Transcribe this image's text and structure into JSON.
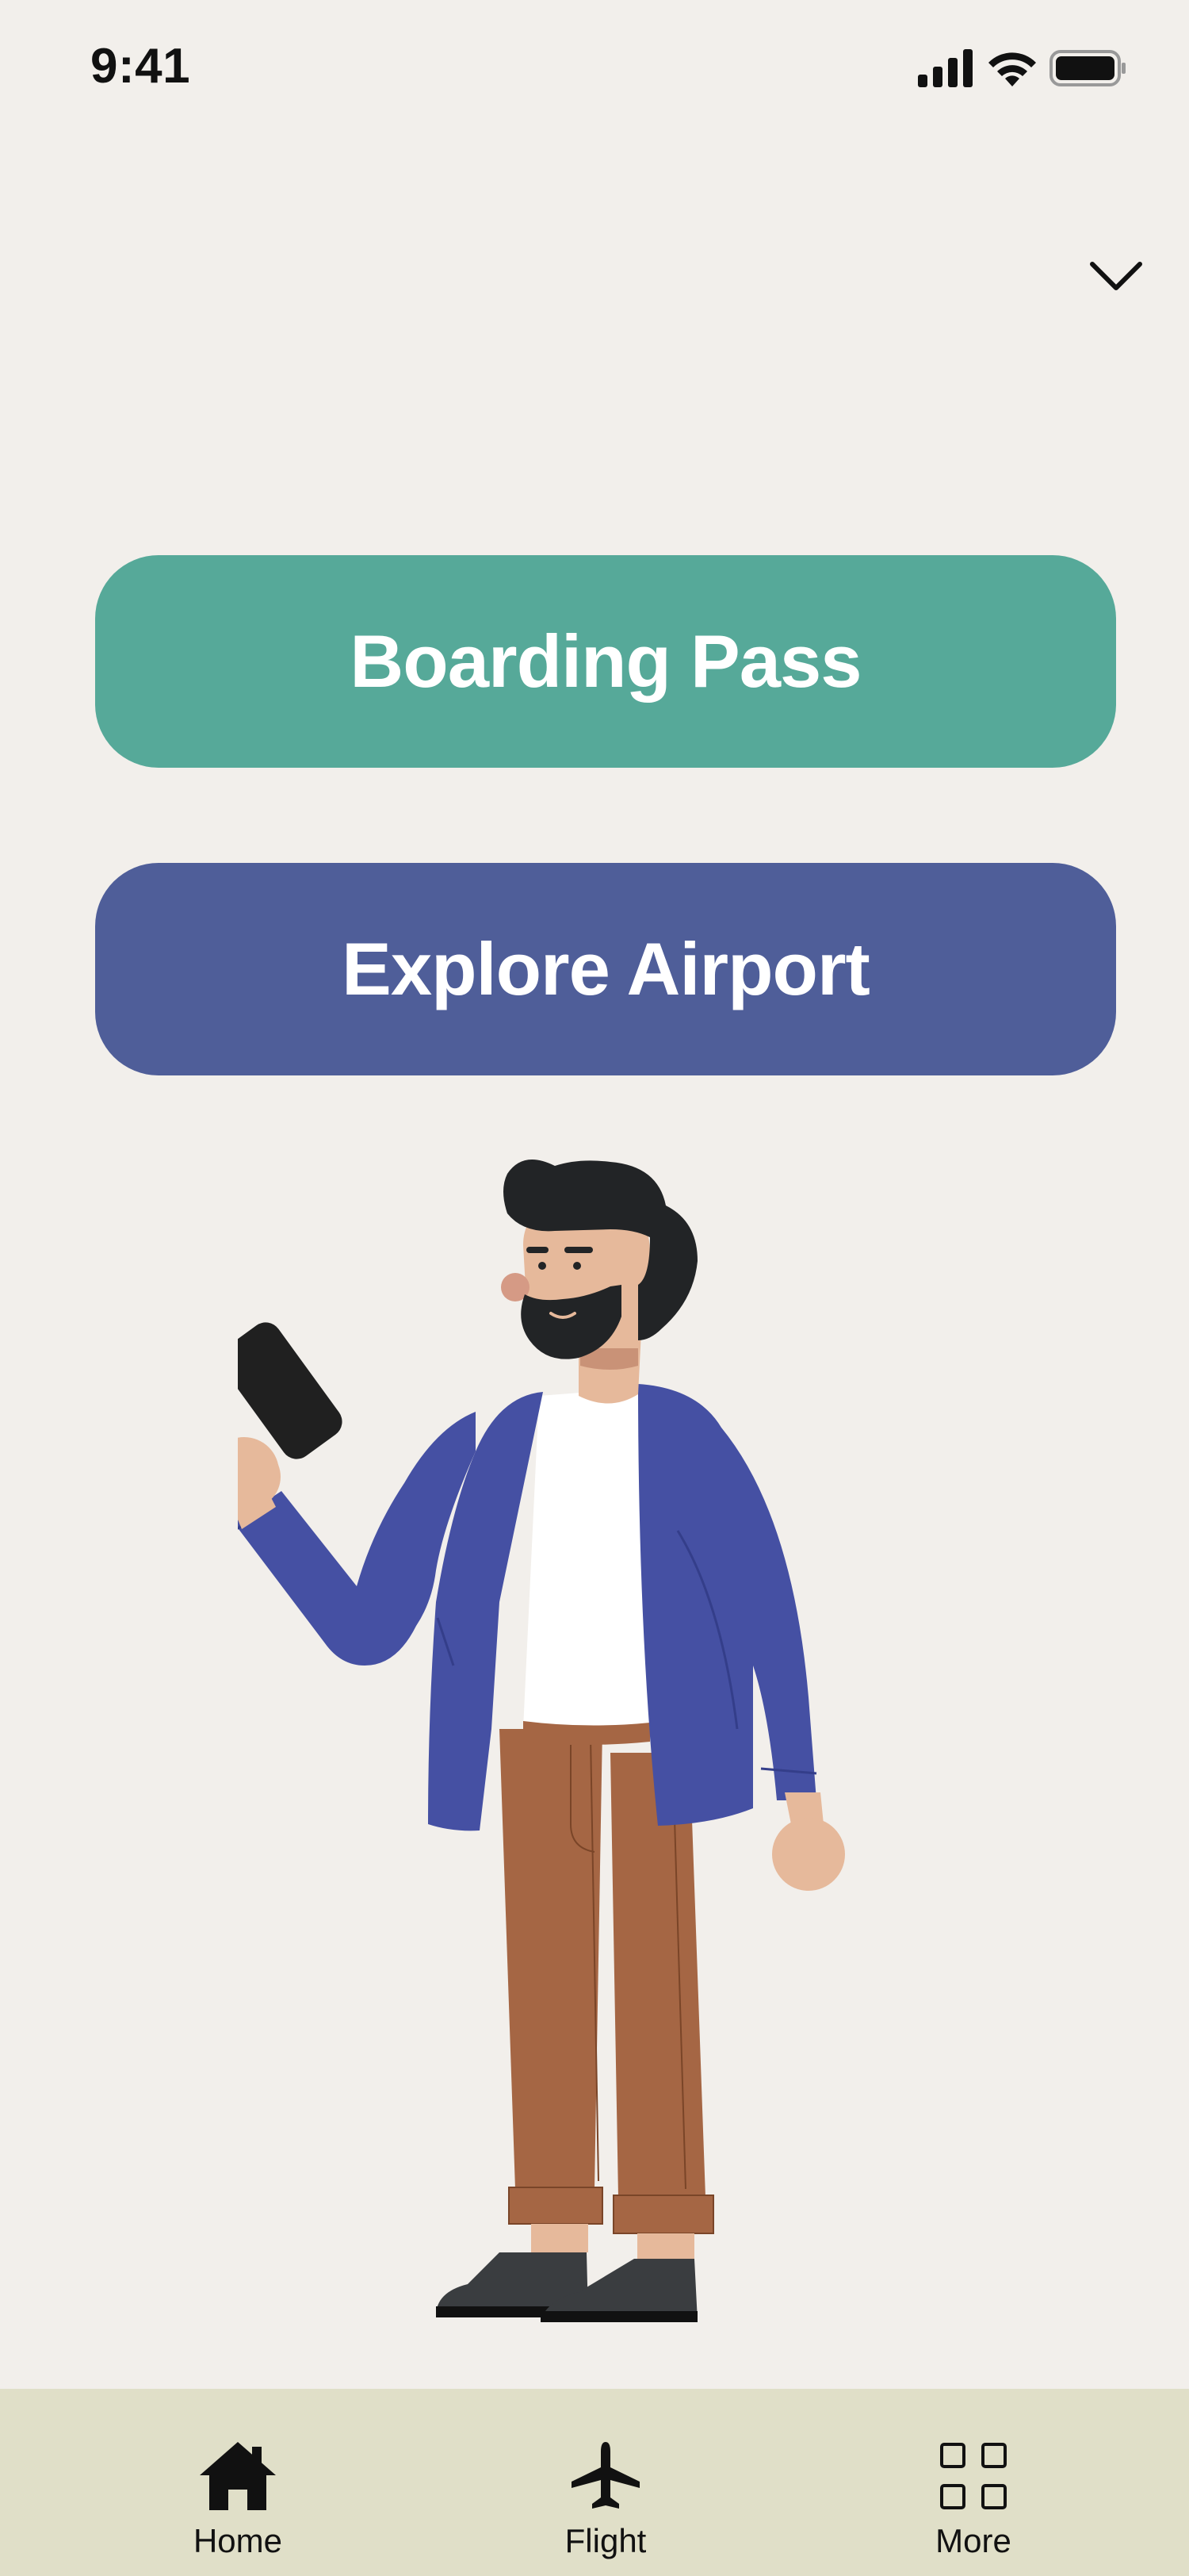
{
  "status_bar": {
    "time": "9:41",
    "icons": [
      "cellular-signal-icon",
      "wifi-icon",
      "battery-icon"
    ]
  },
  "header": {
    "collapse_icon": "chevron-down-icon"
  },
  "actions": {
    "boarding_pass_label": "Boarding Pass",
    "explore_airport_label": "Explore Airport"
  },
  "tab_bar": {
    "items": [
      {
        "label": "Home",
        "icon": "home-icon"
      },
      {
        "label": "Flight",
        "icon": "airplane-icon"
      },
      {
        "label": "More",
        "icon": "grid-icon"
      }
    ]
  },
  "colors": {
    "background": "#F2EFEB",
    "boarding_pass": "#56A999",
    "explore_airport": "#4F5E99",
    "tab_bar": "#E0DFC8",
    "jacket": "#4550A3",
    "pants": "#A56644",
    "hair": "#222426",
    "skin": "#E6B99B"
  }
}
